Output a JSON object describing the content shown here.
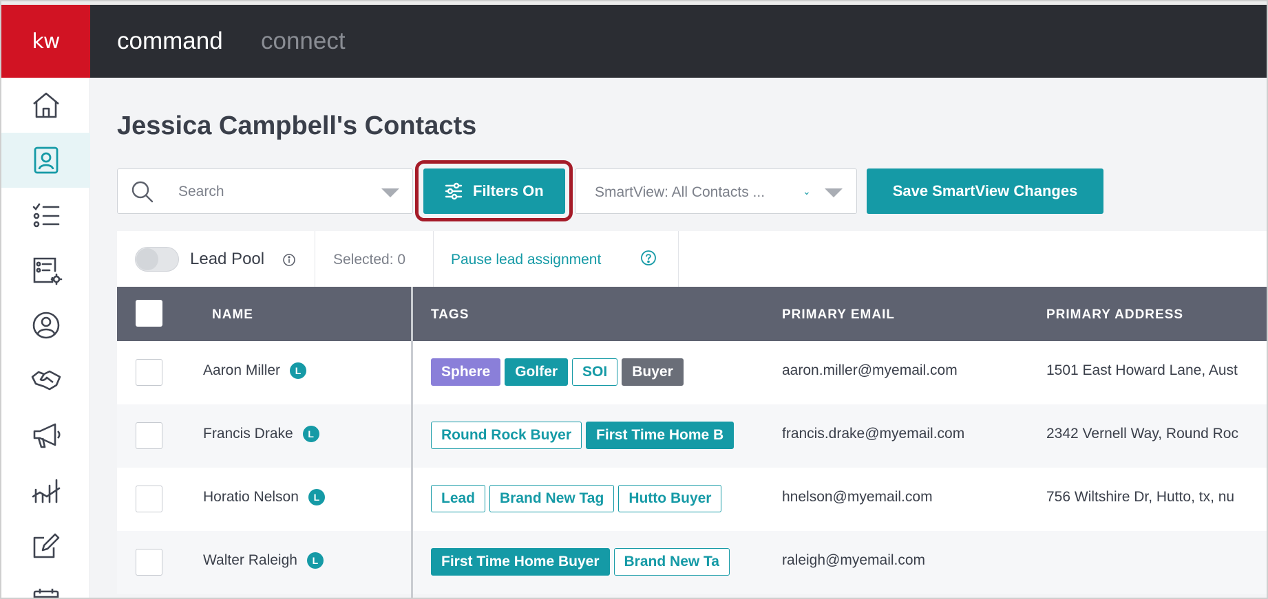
{
  "header": {
    "logo": "kw",
    "nav": [
      "command",
      "connect"
    ]
  },
  "sidebar": {
    "items": [
      {
        "icon": "home-icon",
        "active": false
      },
      {
        "icon": "contacts-icon",
        "active": true
      },
      {
        "icon": "tasks-icon",
        "active": false
      },
      {
        "icon": "settings-list-icon",
        "active": false
      },
      {
        "icon": "user-circle-icon",
        "active": false
      },
      {
        "icon": "handshake-icon",
        "active": false
      },
      {
        "icon": "megaphone-icon",
        "active": false
      },
      {
        "icon": "analytics-icon",
        "active": false
      },
      {
        "icon": "edit-icon",
        "active": false
      }
    ]
  },
  "page": {
    "title": "Jessica Campbell's Contacts"
  },
  "toolbar": {
    "search_placeholder": "Search",
    "filters_label": "Filters On",
    "smartview_label": "SmartView: All Contacts ...",
    "save_label": "Save SmartView Changes"
  },
  "leadbar": {
    "lead_pool_label": "Lead Pool",
    "selected_label": "Selected: 0",
    "pause_label": "Pause lead assignment"
  },
  "table": {
    "columns": [
      "NAME",
      "TAGS",
      "PRIMARY EMAIL",
      "PRIMARY ADDRESS"
    ],
    "rows": [
      {
        "name": "Aaron Miller",
        "badge": "L",
        "tags": [
          {
            "label": "Sphere",
            "style": "purple"
          },
          {
            "label": "Golfer",
            "style": "teal"
          },
          {
            "label": "SOI",
            "style": "outline"
          },
          {
            "label": "Buyer",
            "style": "gray"
          }
        ],
        "email": "aaron.miller@myemail.com",
        "address": "1501 East Howard Lane, Aust"
      },
      {
        "name": "Francis Drake",
        "badge": "L",
        "tags": [
          {
            "label": "Round Rock Buyer",
            "style": "outline"
          },
          {
            "label": "First Time Home B",
            "style": "teal"
          }
        ],
        "email": "francis.drake@myemail.com",
        "address": "2342 Vernell Way, Round Roc"
      },
      {
        "name": "Horatio Nelson",
        "badge": "L",
        "tags": [
          {
            "label": "Lead",
            "style": "outline"
          },
          {
            "label": "Brand New Tag",
            "style": "outline"
          },
          {
            "label": "Hutto Buyer",
            "style": "outline"
          }
        ],
        "email": "hnelson@myemail.com",
        "address": "756 Wiltshire Dr, Hutto, tx, nu"
      },
      {
        "name": "Walter Raleigh",
        "badge": "L",
        "tags": [
          {
            "label": "First Time Home Buyer",
            "style": "teal"
          },
          {
            "label": "Brand New Ta",
            "style": "outline"
          }
        ],
        "email": "raleigh@myemail.com",
        "address": ""
      }
    ]
  },
  "colors": {
    "accent": "#159aa6",
    "brand_red": "#d11323",
    "topbar": "#2b2d33",
    "highlight": "#a51b28",
    "table_header": "#5e6270"
  }
}
